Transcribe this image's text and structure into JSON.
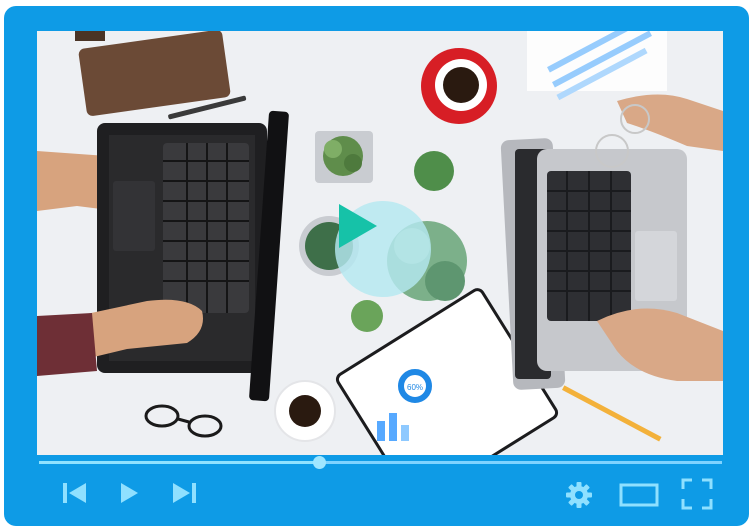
{
  "player": {
    "accent": "#0e9be6",
    "control_color": "#8fe0ff",
    "progress_fraction": 0.41
  },
  "controls": {
    "left": [
      "skip-back-icon",
      "play-icon",
      "skip-forward-icon"
    ],
    "right": [
      "gear-icon",
      "theater-mode-icon",
      "fullscreen-icon"
    ]
  },
  "video": {
    "badge_text": "60%"
  }
}
